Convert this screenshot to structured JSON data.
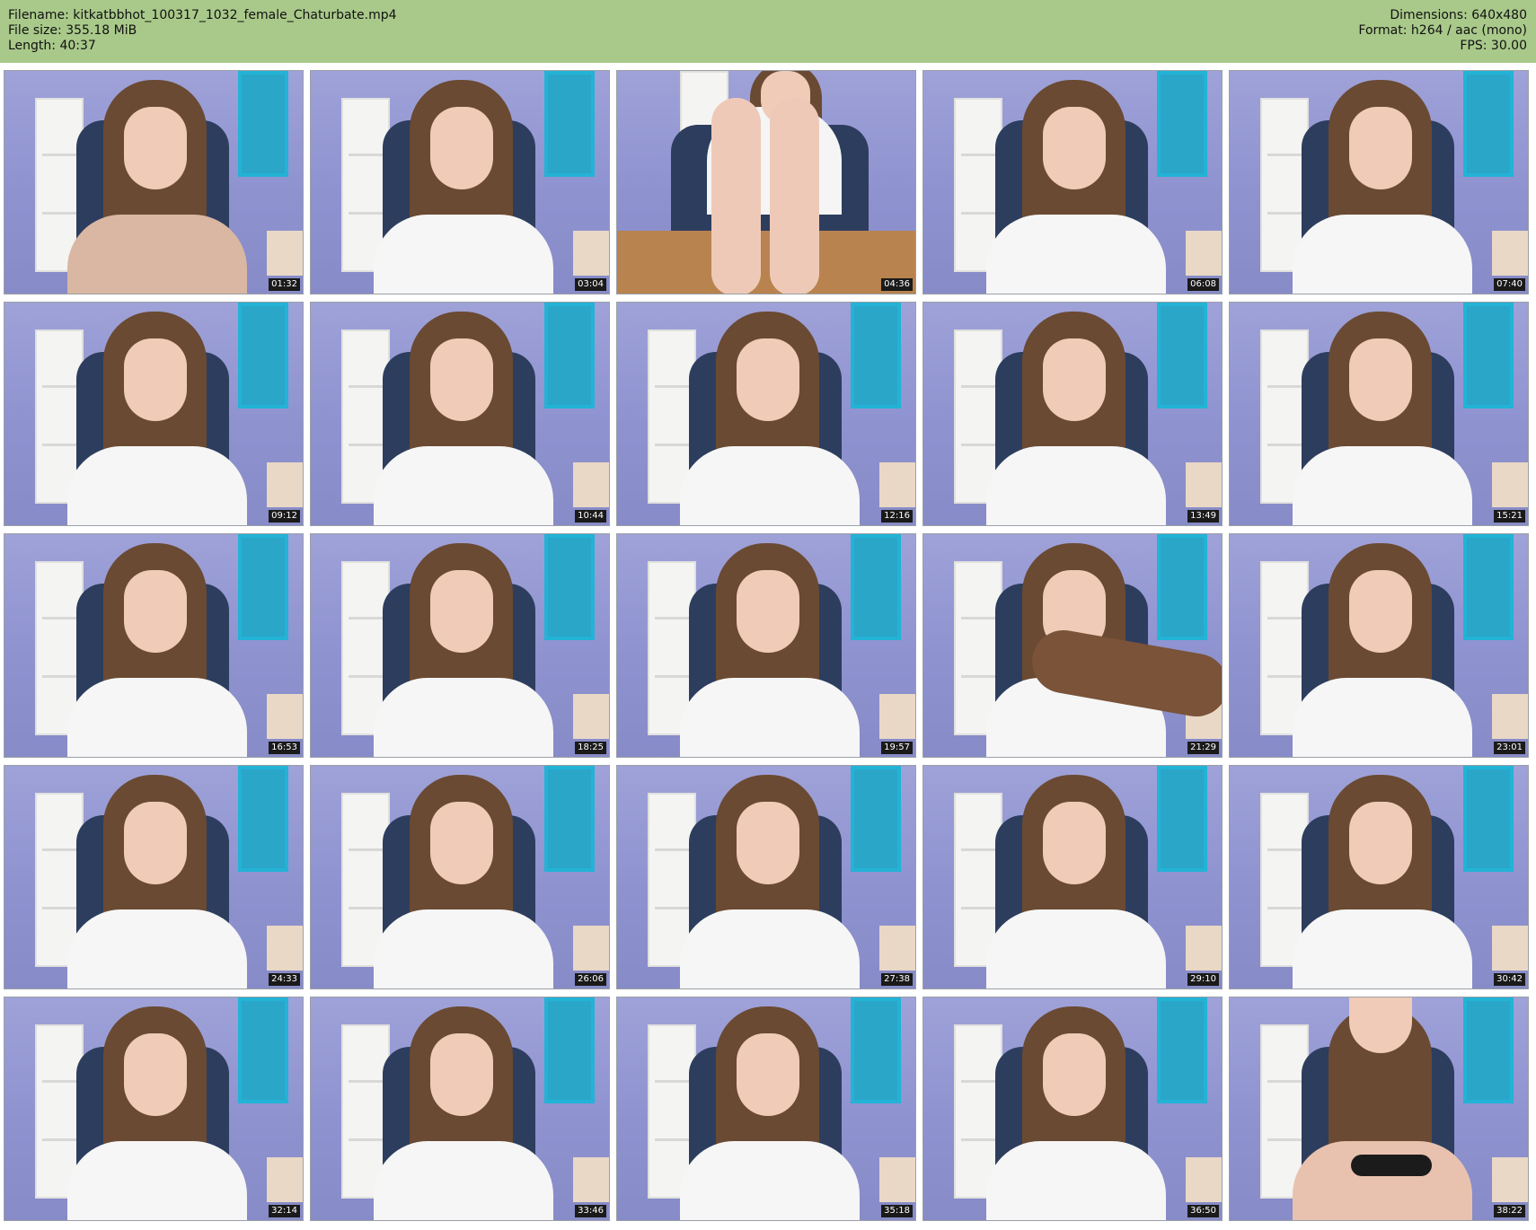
{
  "header": {
    "filename": "Filename: kitkatbbhot_100317_1032_female_Chaturbate.mp4",
    "filesize": "File size: 355.18 MiB",
    "length": "Length: 40:37",
    "dimensions": "Dimensions: 640x480",
    "format": "Format: h264 / aac (mono)",
    "fps": "FPS: 30.00"
  },
  "colors": {
    "header_bg": "#a9c98a",
    "timestamp_bg": "#1a1a1a"
  },
  "thumbnails": [
    {
      "timestamp": "01:32",
      "variant": "tank"
    },
    {
      "timestamp": "03:04",
      "variant": "default"
    },
    {
      "timestamp": "04:36",
      "variant": "legs"
    },
    {
      "timestamp": "06:08",
      "variant": "default"
    },
    {
      "timestamp": "07:40",
      "variant": "default"
    },
    {
      "timestamp": "09:12",
      "variant": "default"
    },
    {
      "timestamp": "10:44",
      "variant": "default"
    },
    {
      "timestamp": "12:16",
      "variant": "default"
    },
    {
      "timestamp": "13:49",
      "variant": "default"
    },
    {
      "timestamp": "15:21",
      "variant": "default"
    },
    {
      "timestamp": "16:53",
      "variant": "default"
    },
    {
      "timestamp": "18:25",
      "variant": "default"
    },
    {
      "timestamp": "19:57",
      "variant": "default"
    },
    {
      "timestamp": "21:29",
      "variant": "hairwave"
    },
    {
      "timestamp": "23:01",
      "variant": "default"
    },
    {
      "timestamp": "24:33",
      "variant": "default"
    },
    {
      "timestamp": "26:06",
      "variant": "default"
    },
    {
      "timestamp": "27:38",
      "variant": "default"
    },
    {
      "timestamp": "29:10",
      "variant": "default"
    },
    {
      "timestamp": "30:42",
      "variant": "default"
    },
    {
      "timestamp": "32:14",
      "variant": "default"
    },
    {
      "timestamp": "33:46",
      "variant": "default"
    },
    {
      "timestamp": "35:18",
      "variant": "default"
    },
    {
      "timestamp": "36:50",
      "variant": "default"
    },
    {
      "timestamp": "38:22",
      "variant": "bra"
    }
  ]
}
